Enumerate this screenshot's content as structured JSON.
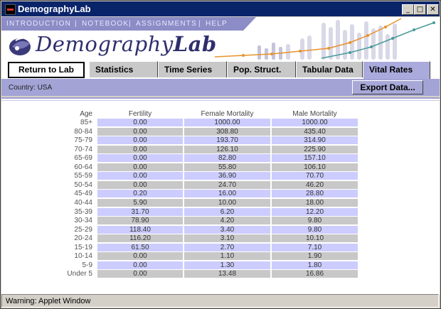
{
  "window": {
    "title": "DemographyLab"
  },
  "top_nav": [
    "INTRODUCTION",
    "NOTEBOOK",
    "ASSIGNMENTS",
    "HELP"
  ],
  "logo": {
    "prefix": "Demography",
    "suffix": "Lab"
  },
  "buttons": {
    "return": "Return to Lab",
    "export": "Export Data..."
  },
  "tabs": [
    "Statistics",
    "Time Series",
    "Pop. Struct.",
    "Tabular Data",
    "Vital Rates"
  ],
  "active_tab": "Vital Rates",
  "country_label": "Country: USA",
  "table": {
    "headers": {
      "age": "Age",
      "fertility": "Fertility",
      "female": "Female Mortality",
      "male": "Male Mortality"
    },
    "rows": [
      [
        "85+",
        "0.00",
        "1000.00",
        "1000.00"
      ],
      [
        "80-84",
        "0.00",
        "308.80",
        "435.40"
      ],
      [
        "75-79",
        "0.00",
        "193.70",
        "314.90"
      ],
      [
        "70-74",
        "0.00",
        "126.10",
        "225.90"
      ],
      [
        "65-69",
        "0.00",
        "82.80",
        "157.10"
      ],
      [
        "60-64",
        "0.00",
        "55.80",
        "106.10"
      ],
      [
        "55-59",
        "0.00",
        "36.90",
        "70.70"
      ],
      [
        "50-54",
        "0.00",
        "24.70",
        "46.20"
      ],
      [
        "45-49",
        "0.20",
        "16.00",
        "28.80"
      ],
      [
        "40-44",
        "5.90",
        "10.00",
        "18.00"
      ],
      [
        "35-39",
        "31.70",
        "6.20",
        "12.20"
      ],
      [
        "30-34",
        "78.90",
        "4.20",
        "9.80"
      ],
      [
        "25-29",
        "118.40",
        "3.40",
        "9.80"
      ],
      [
        "20-24",
        "116.20",
        "3.10",
        "10.10"
      ],
      [
        "15-19",
        "61.50",
        "2.70",
        "7.10"
      ],
      [
        "10-14",
        "0.00",
        "1.10",
        "1.90"
      ],
      [
        "5-9",
        "0.00",
        "1.30",
        "1.80"
      ],
      [
        "Under 5",
        "0.00",
        "13.48",
        "16.86"
      ]
    ]
  },
  "status": "Warning: Applet Window",
  "colors": {
    "title_bar": "#0a246a",
    "nav": "#8c8cc6",
    "band": "#a3a3d6",
    "row_light": "#ccccff",
    "row_dark": "#c8c8c8",
    "accent": "#e8922a"
  }
}
